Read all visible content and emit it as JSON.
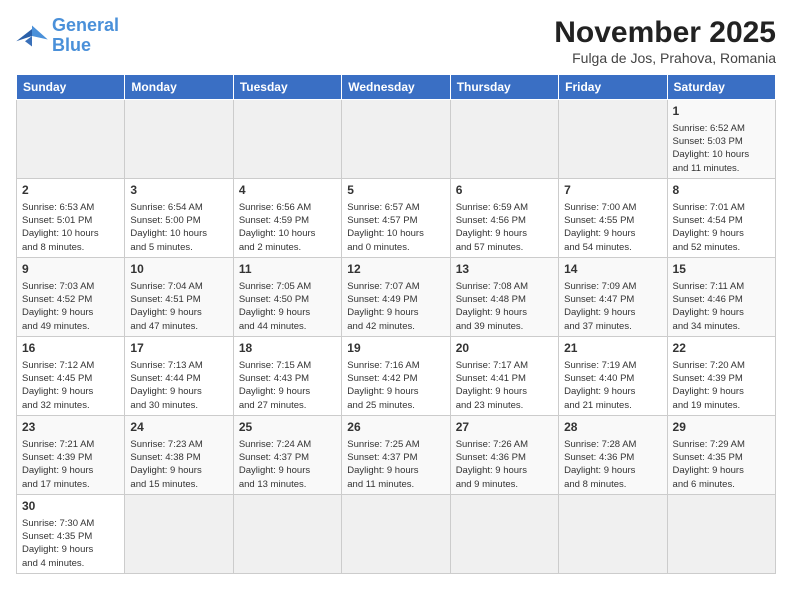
{
  "header": {
    "logo": {
      "line1": "General",
      "line2": "Blue"
    },
    "title": "November 2025",
    "subtitle": "Fulga de Jos, Prahova, Romania"
  },
  "days_of_week": [
    "Sunday",
    "Monday",
    "Tuesday",
    "Wednesday",
    "Thursday",
    "Friday",
    "Saturday"
  ],
  "weeks": [
    [
      {
        "day": "",
        "info": ""
      },
      {
        "day": "",
        "info": ""
      },
      {
        "day": "",
        "info": ""
      },
      {
        "day": "",
        "info": ""
      },
      {
        "day": "",
        "info": ""
      },
      {
        "day": "",
        "info": ""
      },
      {
        "day": "1",
        "info": "Sunrise: 6:52 AM\nSunset: 5:03 PM\nDaylight: 10 hours\nand 11 minutes."
      }
    ],
    [
      {
        "day": "2",
        "info": "Sunrise: 6:53 AM\nSunset: 5:01 PM\nDaylight: 10 hours\nand 8 minutes."
      },
      {
        "day": "3",
        "info": "Sunrise: 6:54 AM\nSunset: 5:00 PM\nDaylight: 10 hours\nand 5 minutes."
      },
      {
        "day": "4",
        "info": "Sunrise: 6:56 AM\nSunset: 4:59 PM\nDaylight: 10 hours\nand 2 minutes."
      },
      {
        "day": "5",
        "info": "Sunrise: 6:57 AM\nSunset: 4:57 PM\nDaylight: 10 hours\nand 0 minutes."
      },
      {
        "day": "6",
        "info": "Sunrise: 6:59 AM\nSunset: 4:56 PM\nDaylight: 9 hours\nand 57 minutes."
      },
      {
        "day": "7",
        "info": "Sunrise: 7:00 AM\nSunset: 4:55 PM\nDaylight: 9 hours\nand 54 minutes."
      },
      {
        "day": "8",
        "info": "Sunrise: 7:01 AM\nSunset: 4:54 PM\nDaylight: 9 hours\nand 52 minutes."
      }
    ],
    [
      {
        "day": "9",
        "info": "Sunrise: 7:03 AM\nSunset: 4:52 PM\nDaylight: 9 hours\nand 49 minutes."
      },
      {
        "day": "10",
        "info": "Sunrise: 7:04 AM\nSunset: 4:51 PM\nDaylight: 9 hours\nand 47 minutes."
      },
      {
        "day": "11",
        "info": "Sunrise: 7:05 AM\nSunset: 4:50 PM\nDaylight: 9 hours\nand 44 minutes."
      },
      {
        "day": "12",
        "info": "Sunrise: 7:07 AM\nSunset: 4:49 PM\nDaylight: 9 hours\nand 42 minutes."
      },
      {
        "day": "13",
        "info": "Sunrise: 7:08 AM\nSunset: 4:48 PM\nDaylight: 9 hours\nand 39 minutes."
      },
      {
        "day": "14",
        "info": "Sunrise: 7:09 AM\nSunset: 4:47 PM\nDaylight: 9 hours\nand 37 minutes."
      },
      {
        "day": "15",
        "info": "Sunrise: 7:11 AM\nSunset: 4:46 PM\nDaylight: 9 hours\nand 34 minutes."
      }
    ],
    [
      {
        "day": "16",
        "info": "Sunrise: 7:12 AM\nSunset: 4:45 PM\nDaylight: 9 hours\nand 32 minutes."
      },
      {
        "day": "17",
        "info": "Sunrise: 7:13 AM\nSunset: 4:44 PM\nDaylight: 9 hours\nand 30 minutes."
      },
      {
        "day": "18",
        "info": "Sunrise: 7:15 AM\nSunset: 4:43 PM\nDaylight: 9 hours\nand 27 minutes."
      },
      {
        "day": "19",
        "info": "Sunrise: 7:16 AM\nSunset: 4:42 PM\nDaylight: 9 hours\nand 25 minutes."
      },
      {
        "day": "20",
        "info": "Sunrise: 7:17 AM\nSunset: 4:41 PM\nDaylight: 9 hours\nand 23 minutes."
      },
      {
        "day": "21",
        "info": "Sunrise: 7:19 AM\nSunset: 4:40 PM\nDaylight: 9 hours\nand 21 minutes."
      },
      {
        "day": "22",
        "info": "Sunrise: 7:20 AM\nSunset: 4:39 PM\nDaylight: 9 hours\nand 19 minutes."
      }
    ],
    [
      {
        "day": "23",
        "info": "Sunrise: 7:21 AM\nSunset: 4:39 PM\nDaylight: 9 hours\nand 17 minutes."
      },
      {
        "day": "24",
        "info": "Sunrise: 7:23 AM\nSunset: 4:38 PM\nDaylight: 9 hours\nand 15 minutes."
      },
      {
        "day": "25",
        "info": "Sunrise: 7:24 AM\nSunset: 4:37 PM\nDaylight: 9 hours\nand 13 minutes."
      },
      {
        "day": "26",
        "info": "Sunrise: 7:25 AM\nSunset: 4:37 PM\nDaylight: 9 hours\nand 11 minutes."
      },
      {
        "day": "27",
        "info": "Sunrise: 7:26 AM\nSunset: 4:36 PM\nDaylight: 9 hours\nand 9 minutes."
      },
      {
        "day": "28",
        "info": "Sunrise: 7:28 AM\nSunset: 4:36 PM\nDaylight: 9 hours\nand 8 minutes."
      },
      {
        "day": "29",
        "info": "Sunrise: 7:29 AM\nSunset: 4:35 PM\nDaylight: 9 hours\nand 6 minutes."
      }
    ],
    [
      {
        "day": "30",
        "info": "Sunrise: 7:30 AM\nSunset: 4:35 PM\nDaylight: 9 hours\nand 4 minutes."
      },
      {
        "day": "",
        "info": ""
      },
      {
        "day": "",
        "info": ""
      },
      {
        "day": "",
        "info": ""
      },
      {
        "day": "",
        "info": ""
      },
      {
        "day": "",
        "info": ""
      },
      {
        "day": "",
        "info": ""
      }
    ]
  ]
}
